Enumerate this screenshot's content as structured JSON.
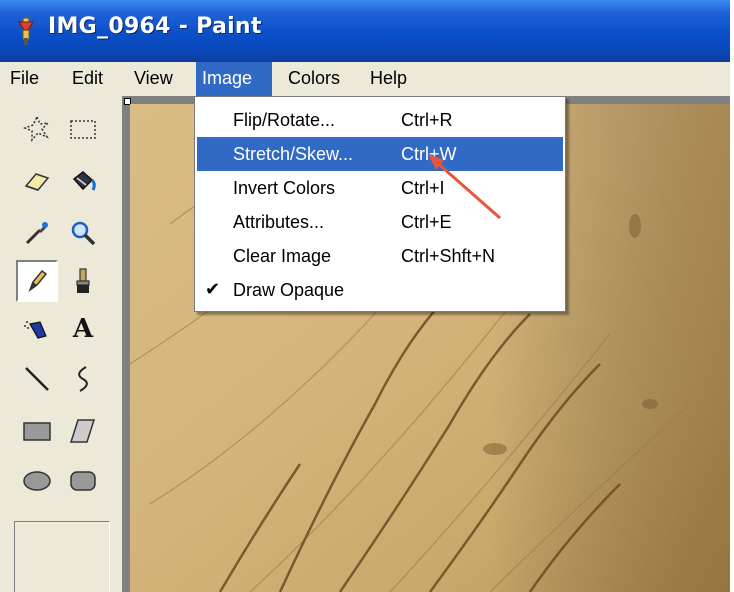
{
  "window": {
    "title": "IMG_0964 - Paint"
  },
  "menubar": {
    "items": [
      "File",
      "Edit",
      "View",
      "Image",
      "Colors",
      "Help"
    ],
    "active": "Image"
  },
  "image_menu": {
    "items": [
      {
        "label": "Flip/Rotate...",
        "shortcut": "Ctrl+R",
        "checked": false,
        "highlighted": false
      },
      {
        "label": "Stretch/Skew...",
        "shortcut": "Ctrl+W",
        "checked": false,
        "highlighted": true
      },
      {
        "label": "Invert Colors",
        "shortcut": "Ctrl+I",
        "checked": false,
        "highlighted": false
      },
      {
        "label": "Attributes...",
        "shortcut": "Ctrl+E",
        "checked": false,
        "highlighted": false
      },
      {
        "label": "Clear Image",
        "shortcut": "Ctrl+Shft+N",
        "checked": false,
        "highlighted": false
      },
      {
        "label": "Draw Opaque",
        "shortcut": "",
        "checked": true,
        "highlighted": false
      }
    ],
    "check_glyph": "✔"
  },
  "toolbox": {
    "tools": [
      "free-form-select-icon",
      "rect-select-icon",
      "eraser-icon",
      "fill-bucket-icon",
      "color-picker-icon",
      "magnifier-icon",
      "pencil-icon",
      "brush-icon",
      "airbrush-icon",
      "text-icon",
      "line-icon",
      "curve-icon",
      "rectangle-icon",
      "polygon-icon",
      "ellipse-icon",
      "rounded-rect-icon"
    ],
    "selected": "pencil-icon",
    "text_tool_glyph": "A"
  },
  "colors": {
    "titlebar": "#0b4fc8",
    "menu_highlight": "#316ac5",
    "chrome": "#ece9d8",
    "annotation_arrow": "#e8543c",
    "canvas_wood": "#d6bb86"
  }
}
